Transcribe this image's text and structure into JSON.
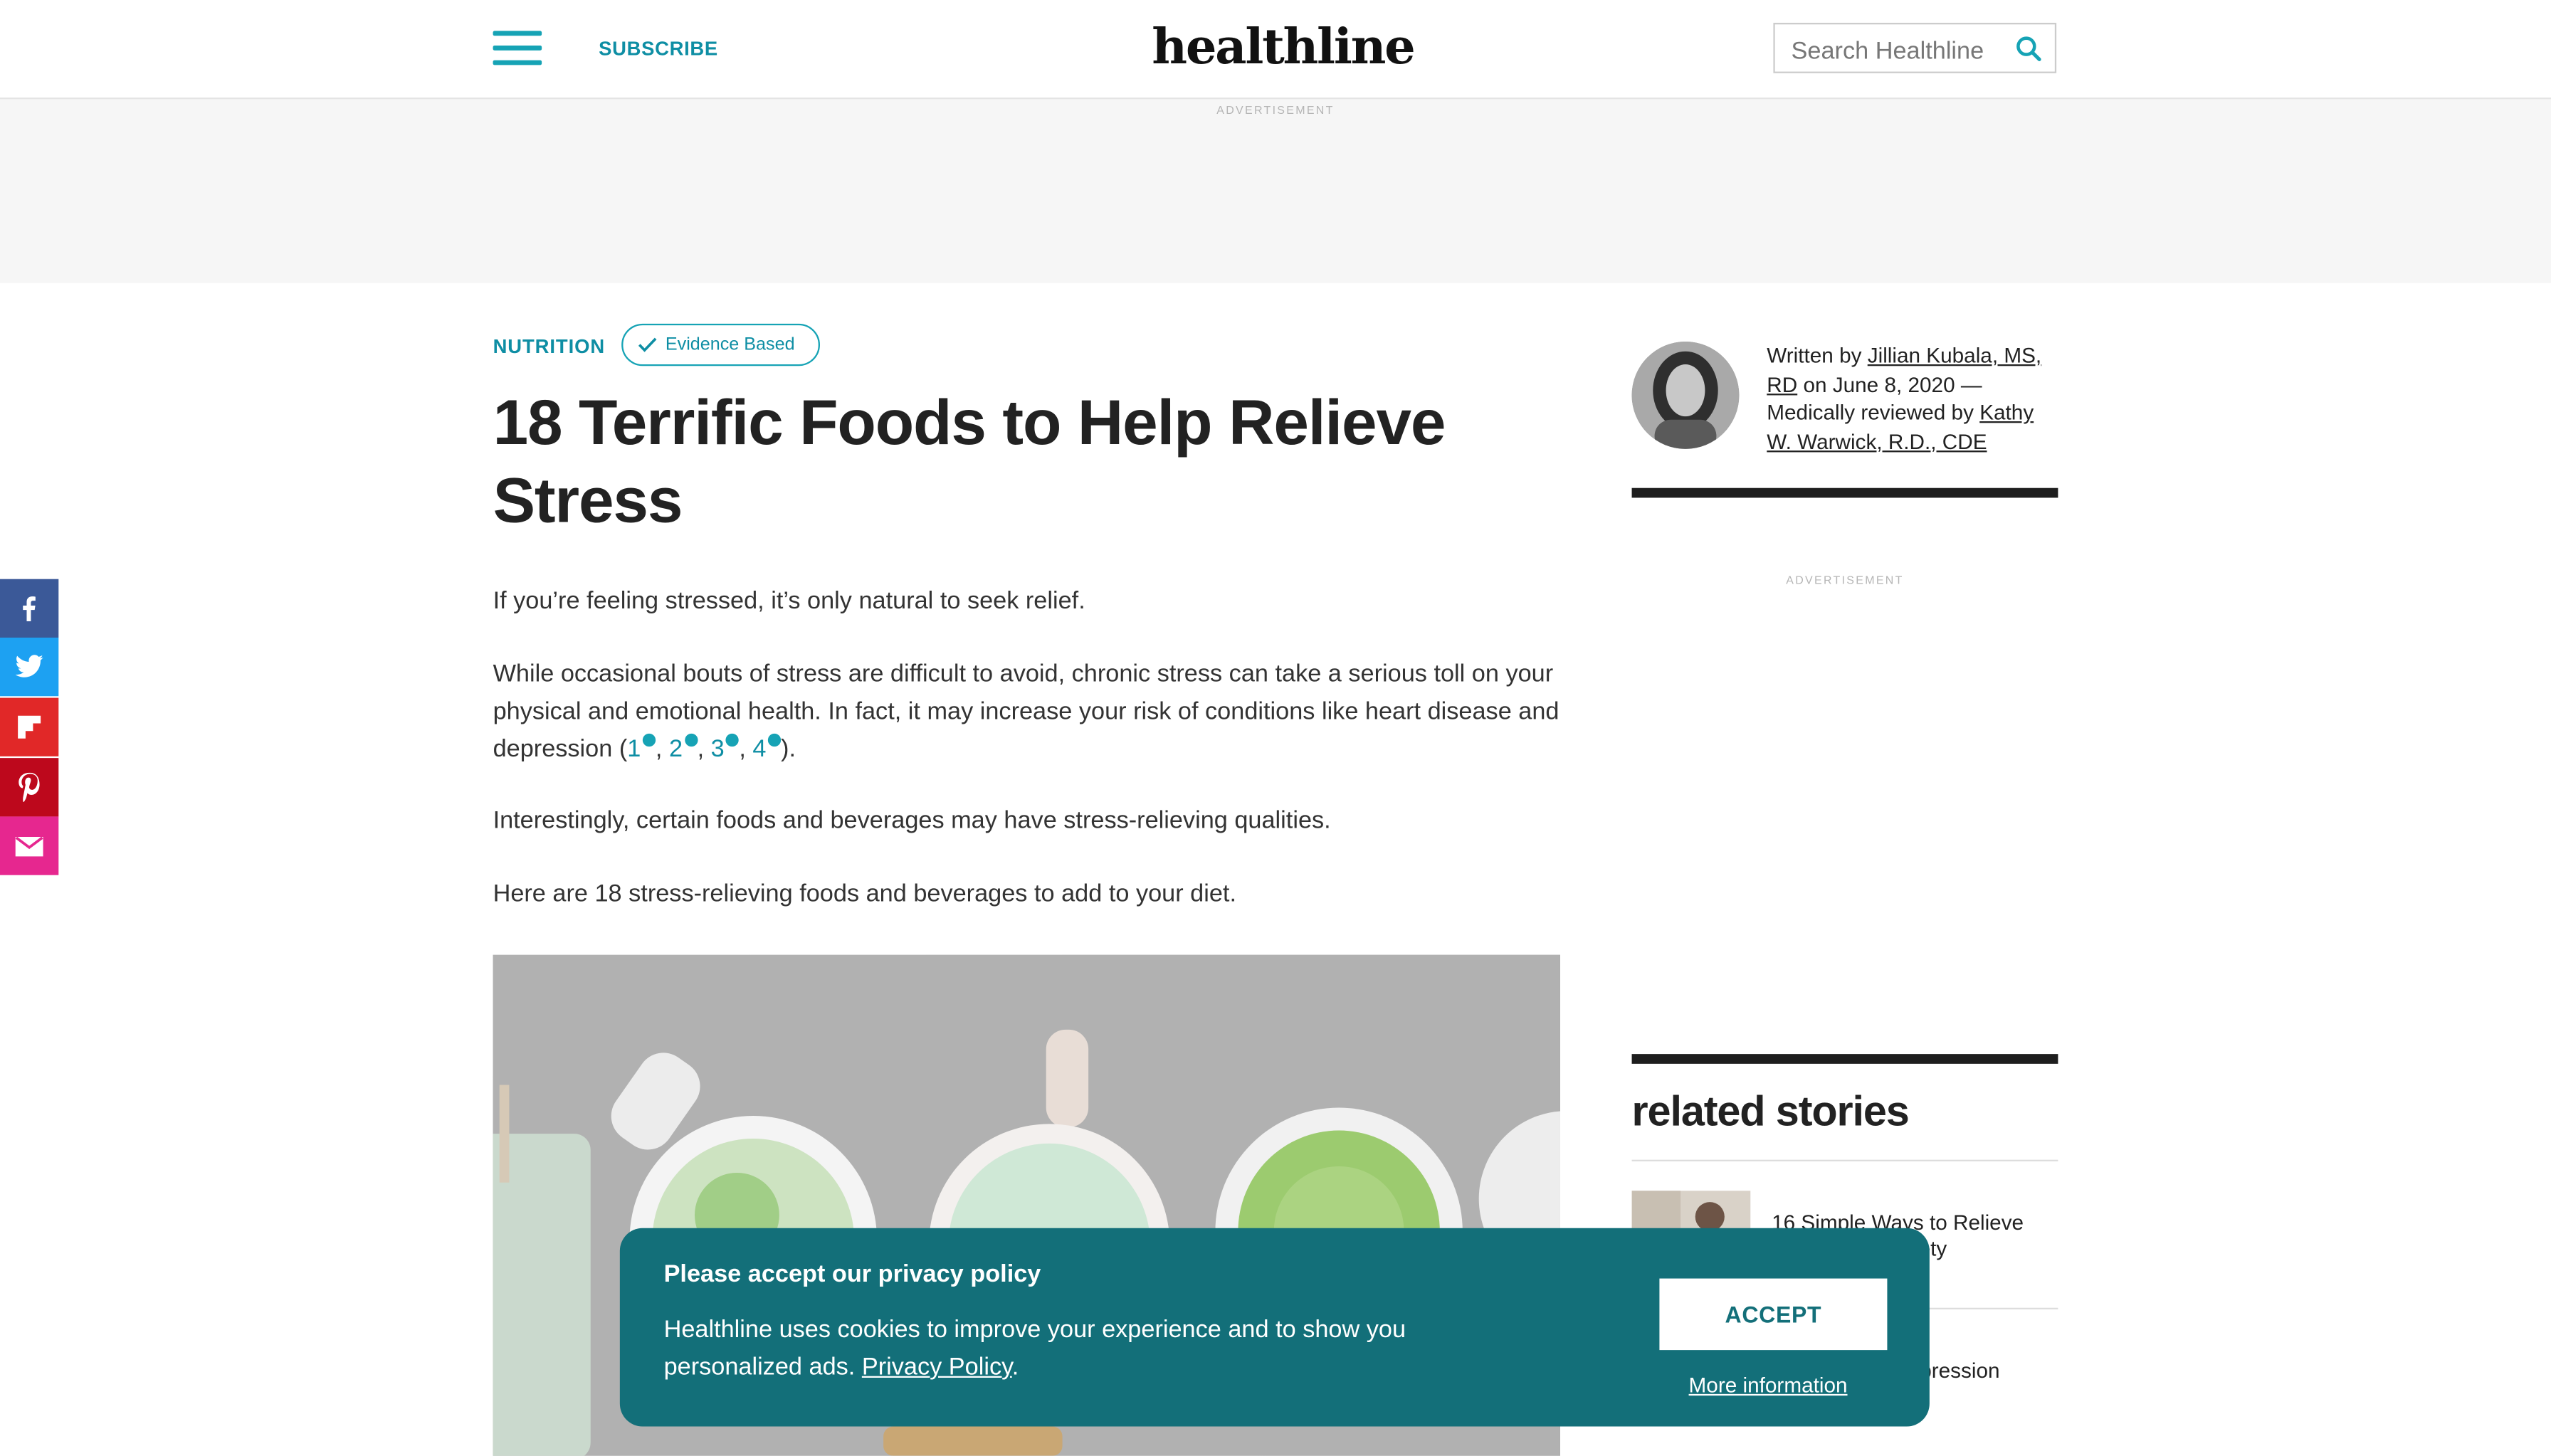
{
  "header": {
    "subscribe_label": "SUBSCRIBE",
    "logo_text": "healthline",
    "search_placeholder": "Search Healthline",
    "accent_color": "#16a3b5"
  },
  "ads": {
    "top_label": "ADVERTISEMENT",
    "side_label": "ADVERTISEMENT"
  },
  "share": {
    "items": [
      {
        "name": "facebook",
        "color": "#3b5998"
      },
      {
        "name": "twitter",
        "color": "#1da1f2"
      },
      {
        "name": "flipboard",
        "color": "#e12828"
      },
      {
        "name": "pinterest",
        "color": "#bd081c"
      },
      {
        "name": "email",
        "color": "#e6278f"
      }
    ]
  },
  "article": {
    "category": "NUTRITION",
    "badge": "Evidence Based",
    "title": "18 Terrific Foods to Help Relieve Stress",
    "intro": "If you’re feeling stressed, it’s only natural to seek relief.",
    "para2_text": "While occasional bouts of stress are difficult to avoid, chronic stress can take a serious toll on your physical and emotional health. In fact, it may increase your risk of conditions like heart disease and depression (",
    "citations": [
      "1",
      "2",
      "3",
      "4"
    ],
    "para2_end": ").",
    "para3": "Interestingly, certain foods and beverages may have stress-relieving qualities.",
    "para4": "Here are 18 stress-relieving foods and beverages to add to your diet."
  },
  "author": {
    "written_by": "Written by ",
    "author_name": "Jillian Kubala, MS, RD",
    "on_date": " on June 8, 2020 — Medically reviewed by ",
    "reviewer": "Kathy W. Warwick, R.D., CDE"
  },
  "related": {
    "heading": "related stories",
    "stories": [
      {
        "title": "16 Simple Ways to Relieve Stress and Anxiety"
      },
      {
        "title": "Nutrients for Depression"
      }
    ]
  },
  "cookie": {
    "title": "Please accept our privacy policy",
    "text": "Healthline uses cookies to improve your experience and to show you personalized ads. ",
    "policy_link": "Privacy Policy",
    "period": ".",
    "accept_label": "ACCEPT",
    "more_label": "More information"
  }
}
